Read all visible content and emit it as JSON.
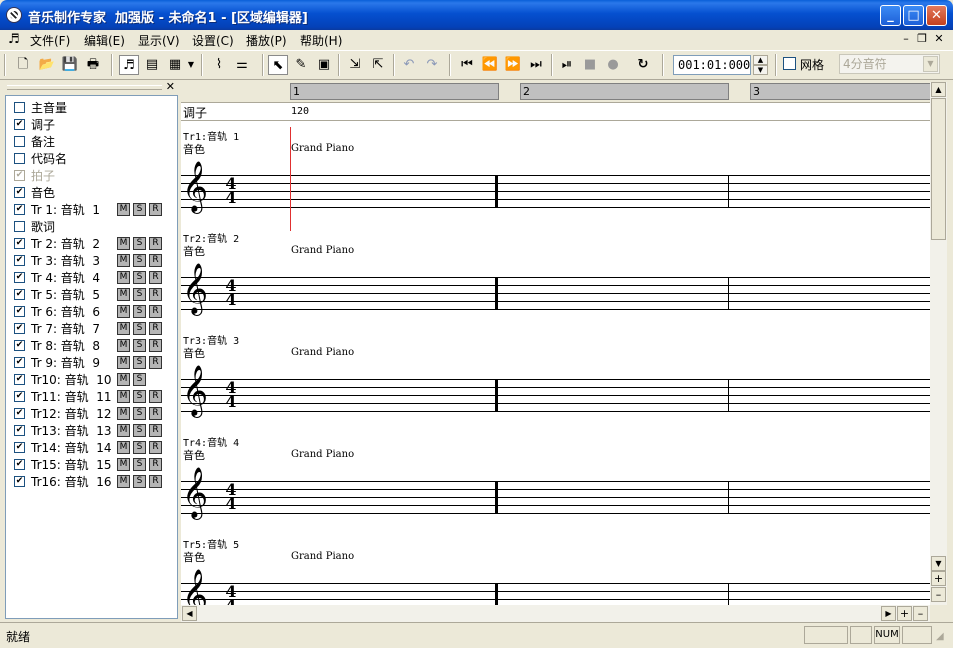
{
  "window": {
    "title": "音乐制作专家  加强版 - 未命名1 - [区域编辑器]",
    "controls": {
      "minimize": "_",
      "maximize": "□",
      "close": "✕"
    }
  },
  "menu": {
    "items": [
      "文件(F)",
      "编辑(E)",
      "显示(V)",
      "设置(C)",
      "播放(P)",
      "帮助(H)"
    ],
    "mdi": {
      "minimize": "–",
      "restore": "❐",
      "close": "✕"
    }
  },
  "toolbar": {
    "time_position": "001:01:000",
    "grid_label": "网格",
    "grid_checked": false,
    "note_value": "4分音符",
    "spin_up": "▲",
    "spin_down": "▼",
    "select_arrow": "▼"
  },
  "left_panel": {
    "close": "✕",
    "rows": [
      {
        "label": "主音量",
        "checked": false,
        "disabled": false
      },
      {
        "label": "调子",
        "checked": true,
        "disabled": false
      },
      {
        "label": "备注",
        "checked": false,
        "disabled": false
      },
      {
        "label": "代码名",
        "checked": false,
        "disabled": false
      },
      {
        "label": "拍子",
        "checked": true,
        "disabled": true
      },
      {
        "label": "音色",
        "checked": true,
        "disabled": false
      },
      {
        "label": "Tr 1: 音轨  1",
        "checked": true,
        "disabled": false,
        "msr": [
          "M",
          "S",
          "R"
        ]
      },
      {
        "label": "歌词",
        "checked": false,
        "disabled": false
      },
      {
        "label": "Tr 2: 音轨  2",
        "checked": true,
        "disabled": false,
        "msr": [
          "M",
          "S",
          "R"
        ]
      },
      {
        "label": "Tr 3: 音轨  3",
        "checked": true,
        "disabled": false,
        "msr": [
          "M",
          "S",
          "R"
        ]
      },
      {
        "label": "Tr 4: 音轨  4",
        "checked": true,
        "disabled": false,
        "msr": [
          "M",
          "S",
          "R"
        ]
      },
      {
        "label": "Tr 5: 音轨  5",
        "checked": true,
        "disabled": false,
        "msr": [
          "M",
          "S",
          "R"
        ]
      },
      {
        "label": "Tr 6: 音轨  6",
        "checked": true,
        "disabled": false,
        "msr": [
          "M",
          "S",
          "R"
        ]
      },
      {
        "label": "Tr 7: 音轨  7",
        "checked": true,
        "disabled": false,
        "msr": [
          "M",
          "S",
          "R"
        ]
      },
      {
        "label": "Tr 8: 音轨  8",
        "checked": true,
        "disabled": false,
        "msr": [
          "M",
          "S",
          "R"
        ]
      },
      {
        "label": "Tr 9: 音轨  9",
        "checked": true,
        "disabled": false,
        "msr": [
          "M",
          "S",
          "R"
        ]
      },
      {
        "label": "Tr10: 音轨  10",
        "checked": true,
        "disabled": false,
        "msr": [
          "M",
          "S"
        ]
      },
      {
        "label": "Tr11: 音轨  11",
        "checked": true,
        "disabled": false,
        "msr": [
          "M",
          "S",
          "R"
        ]
      },
      {
        "label": "Tr12: 音轨  12",
        "checked": true,
        "disabled": false,
        "msr": [
          "M",
          "S",
          "R"
        ]
      },
      {
        "label": "Tr13: 音轨  13",
        "checked": true,
        "disabled": false,
        "msr": [
          "M",
          "S",
          "R"
        ]
      },
      {
        "label": "Tr14: 音轨  14",
        "checked": true,
        "disabled": false,
        "msr": [
          "M",
          "S",
          "R"
        ]
      },
      {
        "label": "Tr15: 音轨  15",
        "checked": true,
        "disabled": false,
        "msr": [
          "M",
          "S",
          "R"
        ]
      },
      {
        "label": "Tr16: 音轨  16",
        "checked": true,
        "disabled": false,
        "msr": [
          "M",
          "S",
          "R"
        ]
      }
    ]
  },
  "editor": {
    "measures": [
      "1",
      "2",
      "3"
    ],
    "key_label": "调子",
    "key_value": "120",
    "voice_label": "音色",
    "time_signature": {
      "top": "4",
      "bottom": "4"
    },
    "clef": "𝄞",
    "tracks": [
      {
        "name": "Tr1:音轨 1",
        "voice": "Grand Piano"
      },
      {
        "name": "Tr2:音轨 2",
        "voice": "Grand Piano"
      },
      {
        "name": "Tr3:音轨 3",
        "voice": "Grand Piano"
      },
      {
        "name": "Tr4:音轨 4",
        "voice": "Grand Piano"
      },
      {
        "name": "Tr5:音轨 5",
        "voice": "Grand Piano"
      }
    ]
  },
  "statusbar": {
    "text": "就绪",
    "num": "NUM"
  },
  "colors": {
    "cursor": "#e03030",
    "titlebar": "#0550d0"
  }
}
